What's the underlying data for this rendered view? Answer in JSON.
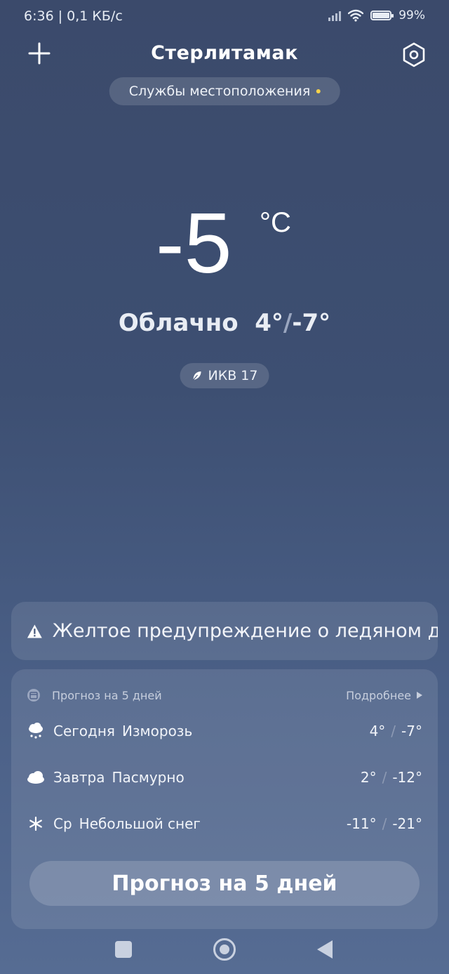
{
  "status_bar": {
    "time_speed": "6:36 | 0,1 КБ/с",
    "battery": "99",
    "battery_level": 0.99
  },
  "header": {
    "city": "Стерлитамак",
    "location_services": "Службы местоположения",
    "add_icon": "plus-icon",
    "settings_icon": "hexagon-settings-icon"
  },
  "current": {
    "temperature": "-5",
    "unit": "°C",
    "condition": "Облачно",
    "high": "4°",
    "low": "-7°",
    "aqi": "ИКВ 17"
  },
  "warning": {
    "text": "Желтое предупреждение о ледяном д..."
  },
  "forecast": {
    "header": "Прогноз на 5 дней",
    "more": "Подробнее",
    "days": [
      {
        "day": "Сегодня",
        "condition": "Изморозь",
        "high": "4°",
        "low": "-7°",
        "icon": "snow-cloud-icon"
      },
      {
        "day": "Завтра",
        "condition": "Пасмурно",
        "high": "2°",
        "low": "-12°",
        "icon": "cloud-icon"
      },
      {
        "day": "Ср",
        "condition": "Небольшой снег",
        "high": "-11°",
        "low": "-21°",
        "icon": "snowflake-icon"
      }
    ],
    "button": "Прогноз на 5 дней"
  },
  "colors": {
    "background_top": "#3b4a6b",
    "background_bottom": "#566c93",
    "location_dot": "#f7d24a"
  }
}
